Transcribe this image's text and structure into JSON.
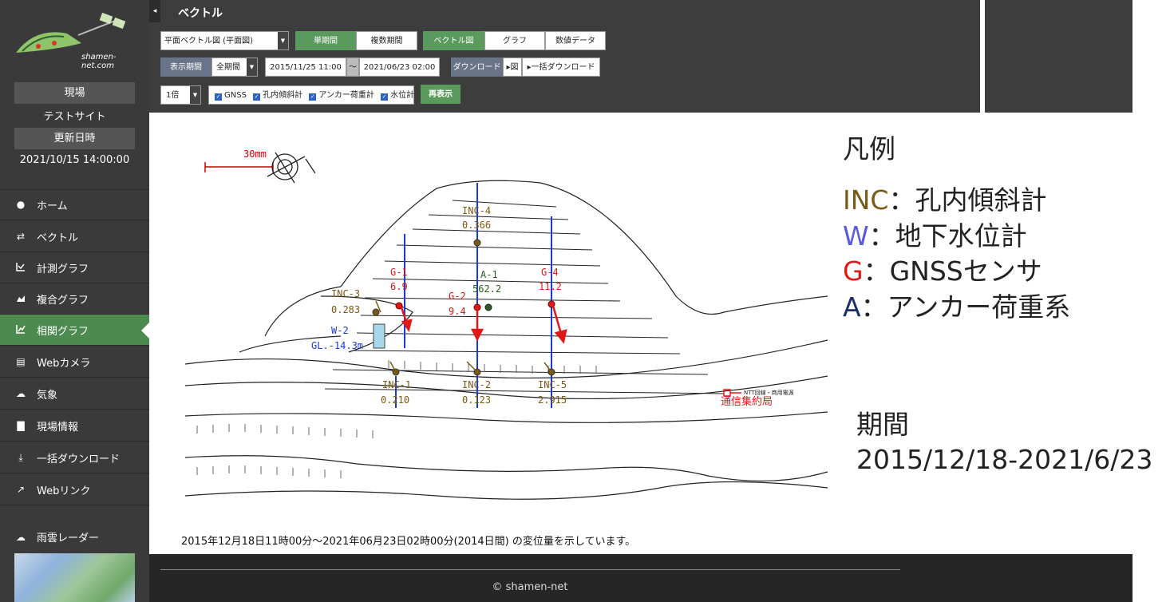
{
  "sidebar": {
    "logo_text": "shamen-net.com",
    "site_label": "現場",
    "site_value": "テストサイト",
    "updated_label": "更新日時",
    "updated_value": "2021/10/15 14:00:00",
    "nav": [
      {
        "icon": "alert-icon",
        "label": "ホーム"
      },
      {
        "icon": "arrows-icon",
        "label": "ベクトル"
      },
      {
        "icon": "line-chart-icon",
        "label": "計測グラフ"
      },
      {
        "icon": "area-chart-icon",
        "label": "複合グラフ"
      },
      {
        "icon": "trend-chart-icon",
        "label": "相関グラフ"
      },
      {
        "icon": "file-icon",
        "label": "Webカメラ"
      },
      {
        "icon": "cloud-icon",
        "label": "気象"
      },
      {
        "icon": "document-icon",
        "label": "現場情報"
      },
      {
        "icon": "download-icon",
        "label": "一括ダウンロード"
      },
      {
        "icon": "external-link-icon",
        "label": "Webリンク"
      }
    ],
    "radar_label": "雨雲レーダー"
  },
  "toolbar": {
    "title": "ベクトル",
    "view_select": "平面ベクトル図 (平面図)",
    "single_period": "単期間",
    "multi_period": "複数期間",
    "tab_vector": "ベクトル図",
    "tab_graph": "グラフ",
    "tab_numeric": "数値データ",
    "period_label": "表示期間",
    "period_select": "全期間",
    "date_from": "2015/11/25 11:00",
    "tilde": "〜",
    "date_to": "2021/06/23 02:00",
    "download_label": "ダウンロード",
    "download_fig": "▸図",
    "download_bulk": "▸一括ダウンロード",
    "scale_select": "1倍",
    "cb_gnss": "GNSS",
    "cb_inc": "孔内傾斜計",
    "cb_anchor": "アンカー荷重計",
    "cb_water": "水位計",
    "redisplay": "再表示"
  },
  "drawing": {
    "scale_label": "30mm",
    "instruments": [
      {
        "name": "INC-4",
        "value": "0.366"
      },
      {
        "name": "INC-3",
        "value": "0.283"
      },
      {
        "name": "INC-1",
        "value": "0.210"
      },
      {
        "name": "INC-2",
        "value": "0.123"
      },
      {
        "name": "INC-5",
        "value": "2.915"
      },
      {
        "name": "G-1",
        "value": "6.9"
      },
      {
        "name": "G-2",
        "value": "9.4"
      },
      {
        "name": "G-4",
        "value": "11.2"
      },
      {
        "name": "A-1",
        "value": "562.2"
      },
      {
        "name": "W-2",
        "value": "GL.-14.3m"
      }
    ],
    "station_label": "通信集約局",
    "ntt_label": "NTT回線・商用電源",
    "caption": "2015年12月18日11時00分〜2021年06月23日02時00分(2014日間) の変位量を示しています。"
  },
  "footer": {
    "copyright": "© shamen-net"
  },
  "legend": {
    "title": "凡例",
    "rows": [
      {
        "key": "INC",
        "color": "#7a5a14",
        "desc": "：孔内傾斜計"
      },
      {
        "key": "W",
        "color": "#5a5ae0",
        "desc": "：地下水位計"
      },
      {
        "key": "G",
        "color": "#e01818",
        "desc": "：GNSSセンサ"
      },
      {
        "key": "A",
        "color": "#1e2e6a",
        "desc": "：アンカー荷重系"
      }
    ],
    "period_title": "期間",
    "period_value": "2015/12/18-2021/6/23"
  }
}
